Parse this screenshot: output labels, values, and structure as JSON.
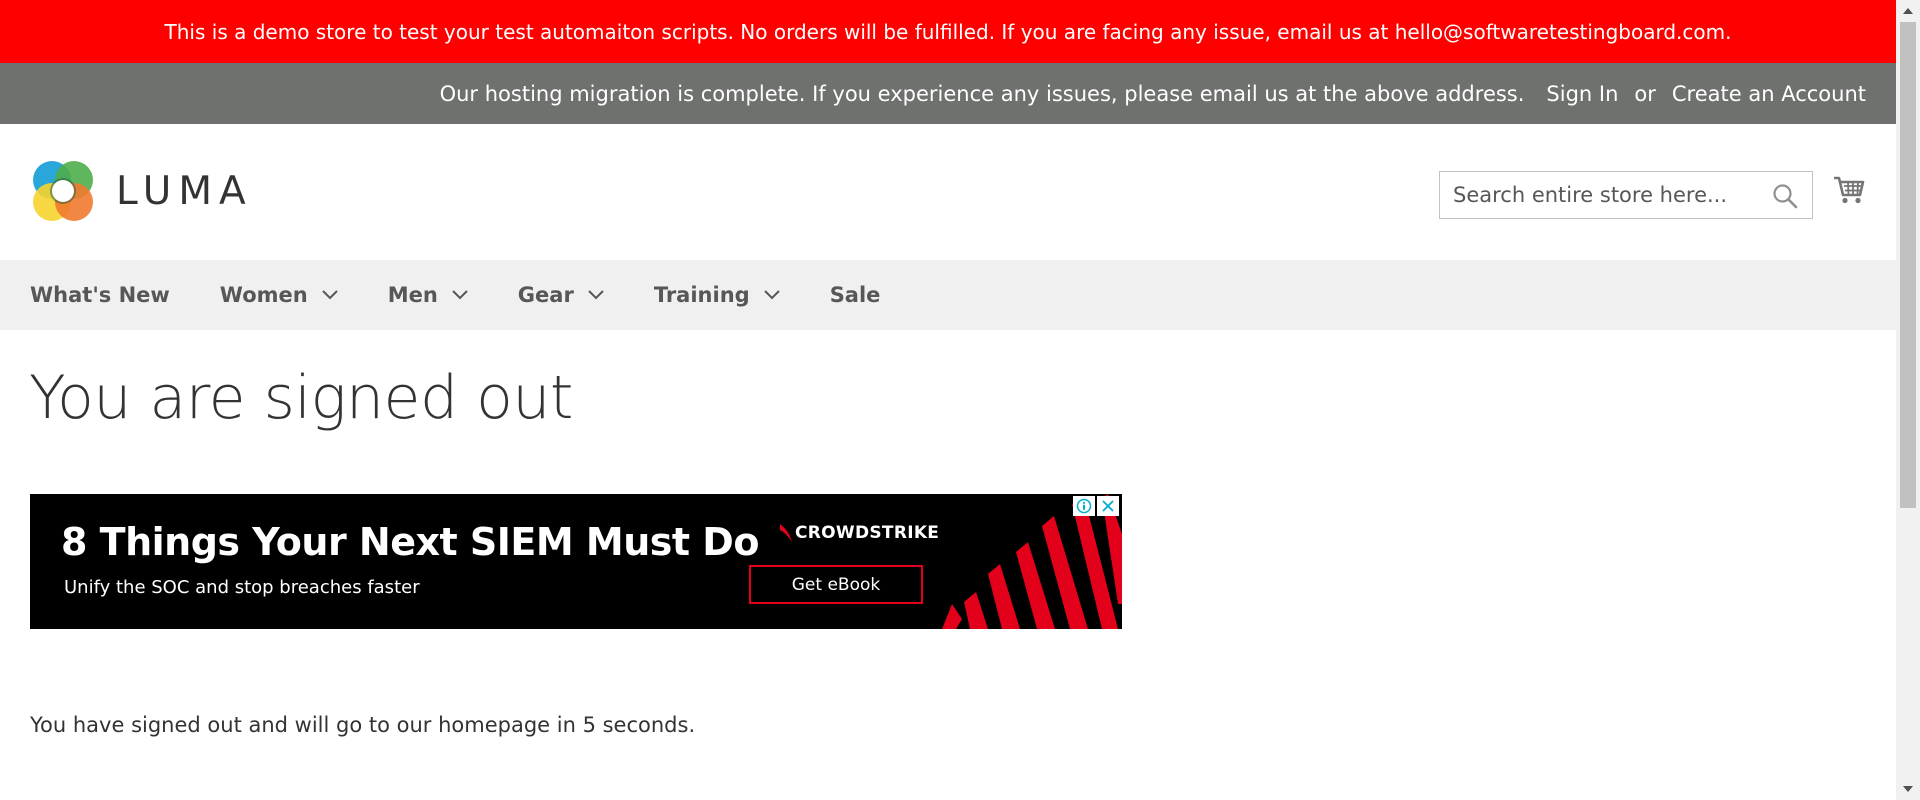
{
  "demo_banner": {
    "text": "This is a demo store to test your test automaiton scripts. No orders will be fulfilled. If you are facing any issue, email us at hello@softwaretestingboard.com."
  },
  "panel_header": {
    "message": "Our hosting migration is complete. If you experience any issues, please email us at the above address.",
    "sign_in": "Sign In",
    "or": "or",
    "create_account": "Create an Account"
  },
  "logo": {
    "text": "LUMA",
    "icon": "luma-logo-icon"
  },
  "search": {
    "placeholder": "Search entire store here...",
    "icon": "search-icon"
  },
  "cart": {
    "icon": "cart-icon"
  },
  "nav": {
    "items": [
      {
        "label": "What's New",
        "has_dropdown": false
      },
      {
        "label": "Women",
        "has_dropdown": true
      },
      {
        "label": "Men",
        "has_dropdown": true
      },
      {
        "label": "Gear",
        "has_dropdown": true
      },
      {
        "label": "Training",
        "has_dropdown": true
      },
      {
        "label": "Sale",
        "has_dropdown": false
      }
    ]
  },
  "main": {
    "title": "You are signed out",
    "message": "You have signed out and will go to our homepage in 5 seconds."
  },
  "ad": {
    "headline": "8 Things Your Next SIEM Must Do",
    "subline": "Unify the SOC and stop breaches faster",
    "brand": "CROWDSTRIKE",
    "cta": "Get eBook",
    "accent_color": "#e3001b"
  },
  "colors": {
    "demo_banner_bg": "#ff0000",
    "panel_header_bg": "#6e716e",
    "nav_bg": "#f0f0f0"
  }
}
